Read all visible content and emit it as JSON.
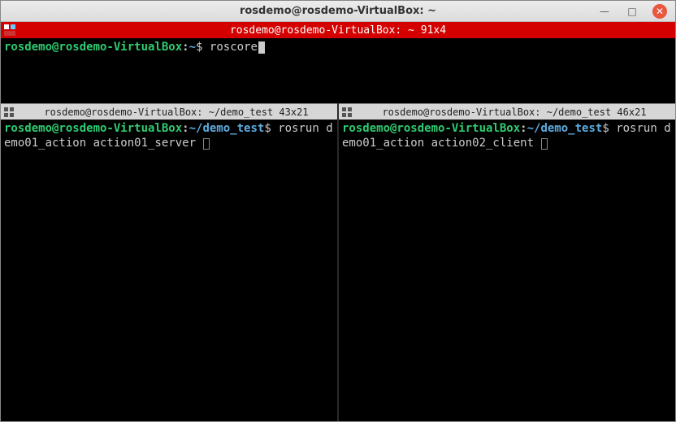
{
  "os": {
    "title": "rosdemo@rosdemo-VirtualBox: ~",
    "min": "—",
    "max": "□",
    "close": "✕"
  },
  "active_title": "rosdemo@rosdemo-VirtualBox: ~ 91x4",
  "top": {
    "user": "rosdemo@rosdemo-VirtualBox",
    "path": "~",
    "dollar": "$",
    "command": "roscore"
  },
  "left": {
    "title": "rosdemo@rosdemo-VirtualBox: ~/demo_test 43x21",
    "user": "rosdemo@rosdemo-VirtualBox",
    "path": "~/demo_test",
    "dollar": "$",
    "command": "rosrun demo01_action action01_server "
  },
  "right": {
    "title": "rosdemo@rosdemo-VirtualBox: ~/demo_test 46x21",
    "user": "rosdemo@rosdemo-VirtualBox",
    "path": "~/demo_test",
    "dollar": "$",
    "command": "rosrun demo01_action action02_client "
  }
}
